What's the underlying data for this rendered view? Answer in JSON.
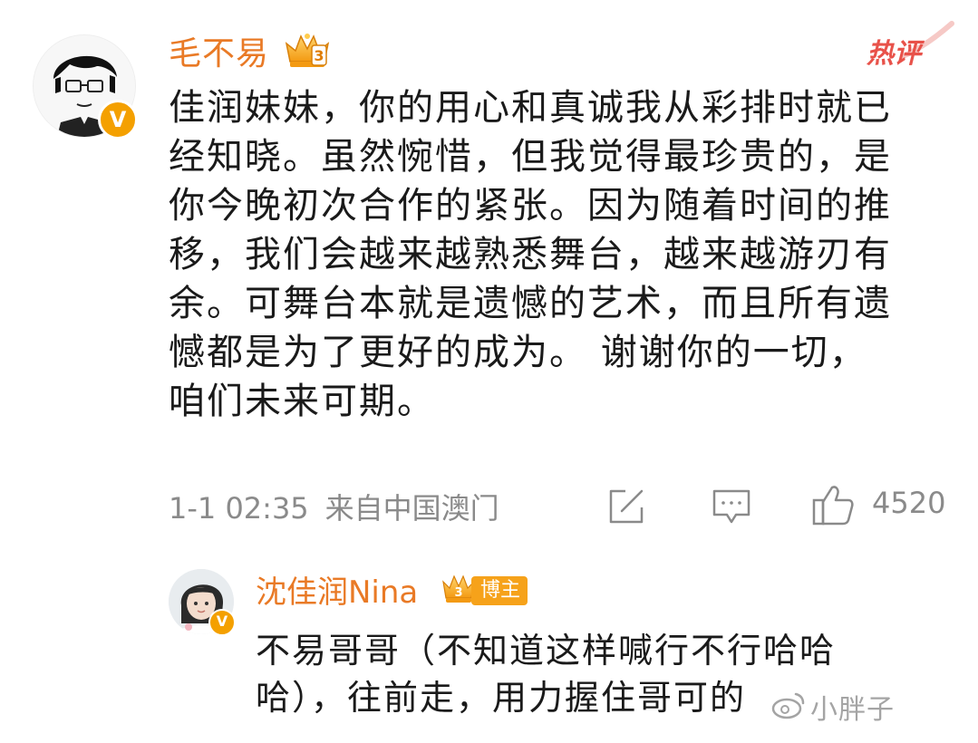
{
  "comment": {
    "username": "毛不易",
    "hot_label": "热评",
    "avatar_icon": "cartoon-face-avatar",
    "verified_icon": "verified-v-badge",
    "verified_letter": "V",
    "lines": [
      "佳润妹妹，你的用心和真诚我从彩排时就已",
      "经知晓。虽然惋惜，但我觉得最珍贵的，是",
      "你今晚初次合作的紧张。因为随着时间的推",
      "移，我们会越来越熟悉舞台，越来越游刃有",
      "余。可舞台本就是遗憾的艺术，而且所有遗",
      "憾都是为了更好的成为。 谢谢你的一切，",
      "咱们未来可期。"
    ],
    "time": "1-1 02:35",
    "location": "来自中国澳门",
    "like_count": "4520",
    "crown_level": "3",
    "accent_color": "#e97a26",
    "hot_color": "#e8524a"
  },
  "reply": {
    "username": "沈佳润Nina",
    "author_tag": "博主",
    "crown_level": "3",
    "verified_letter": "V",
    "avatar_icon": "girl-photo-avatar",
    "lines": [
      "不易哥哥（不知道这样喊行不行哈哈",
      "哈），往前走，用力握住哥可的"
    ]
  },
  "watermark": {
    "text": "小胖子",
    "icon": "weibo-logo-icon"
  }
}
